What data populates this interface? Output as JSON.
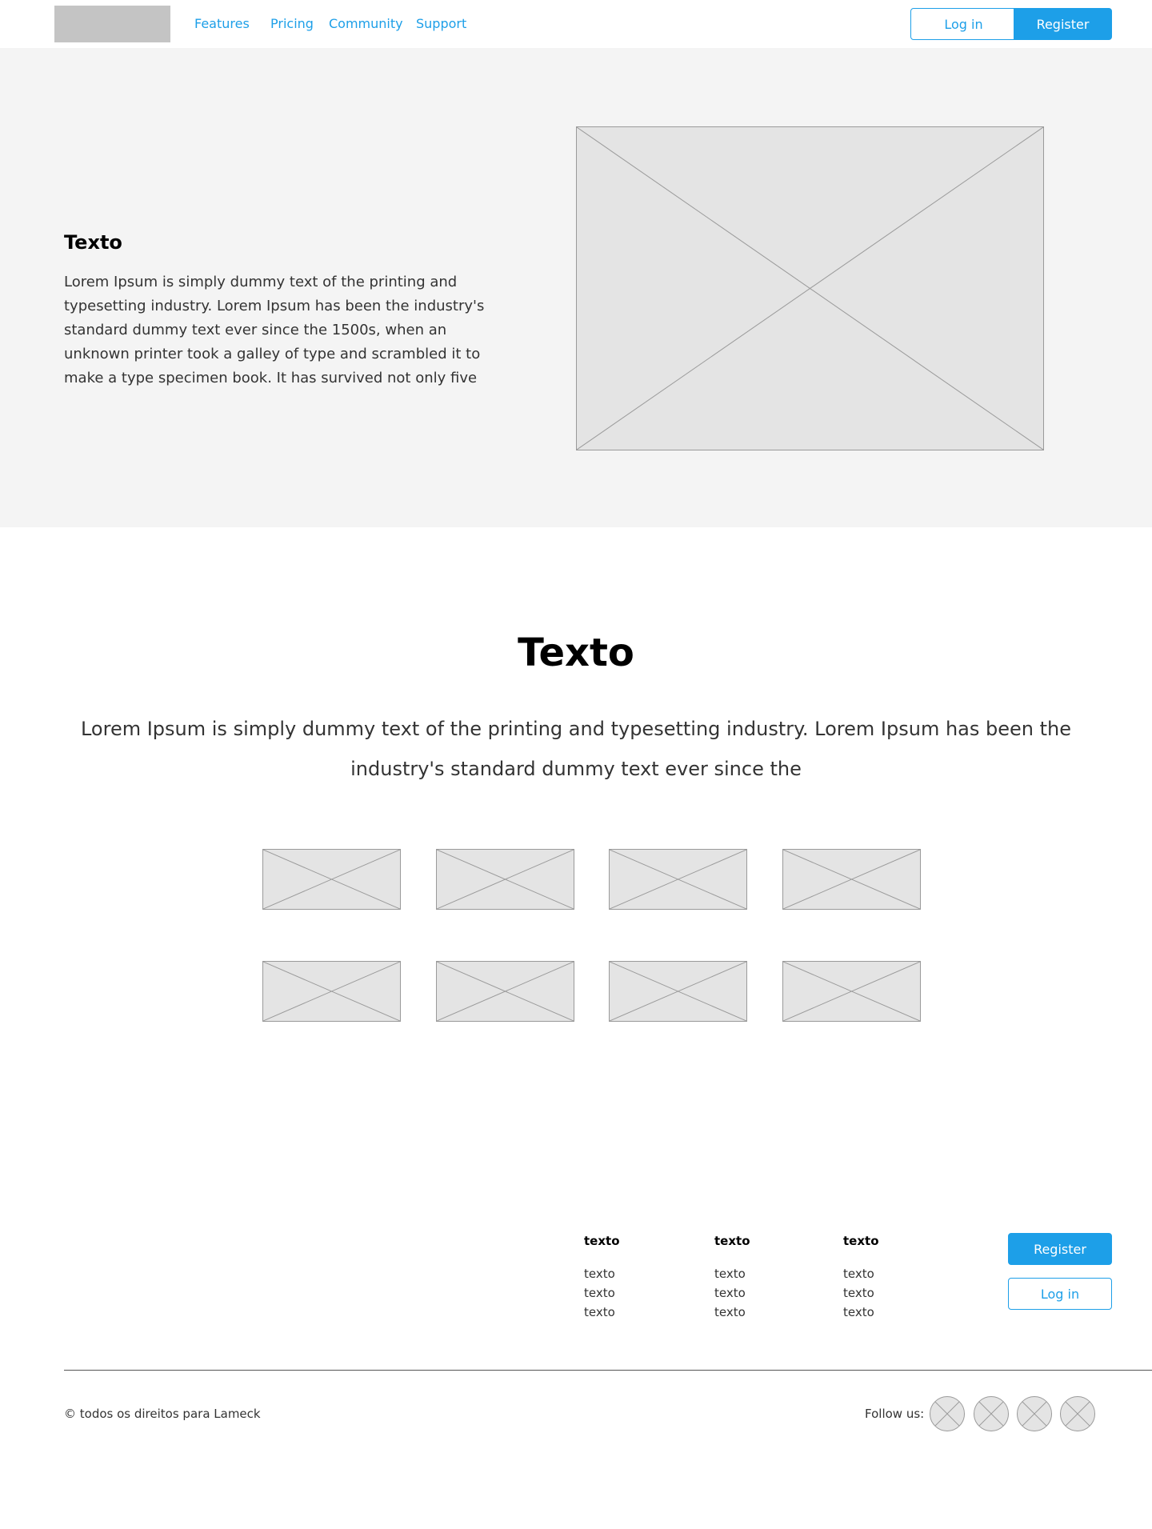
{
  "header": {
    "nav": [
      "Features",
      "Pricing",
      "Community",
      "Support"
    ],
    "login_label": "Log in",
    "register_label": "Register"
  },
  "hero": {
    "title": "Texto",
    "text": "Lorem Ipsum is simply dummy text of the printing and typesetting industry. Lorem Ipsum has been the industry's standard dummy text ever since the 1500s, when an unknown printer took a galley of type and scrambled it to make a type specimen book. It has survived not only five"
  },
  "section": {
    "title": "Texto",
    "text": "Lorem Ipsum is simply dummy text of the printing and typesetting industry. Lorem Ipsum has been the industry's standard dummy text ever since the"
  },
  "footer": {
    "columns": [
      {
        "title": "texto",
        "links": [
          "texto",
          "texto",
          "texto"
        ]
      },
      {
        "title": "texto",
        "links": [
          "texto",
          "texto",
          "texto"
        ]
      },
      {
        "title": "texto",
        "links": [
          "texto",
          "texto",
          "texto"
        ]
      }
    ],
    "register_label": "Register",
    "login_label": "Log in",
    "copyright": "© todos os direitos para Lameck",
    "follow_label": "Follow us:"
  },
  "colors": {
    "accent": "#1d9fe8",
    "hero_background": "#f4f4f4",
    "placeholder_fill": "#e4e4e4",
    "logo_fill": "#c4c4c4"
  }
}
